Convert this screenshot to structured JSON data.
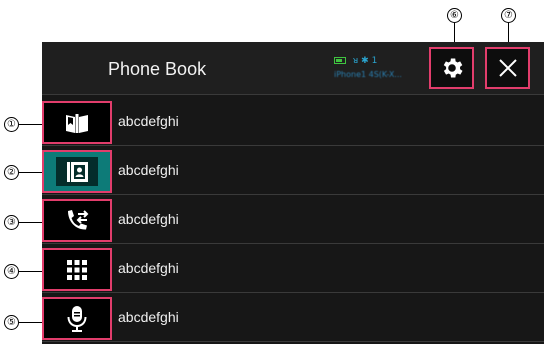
{
  "header": {
    "title": "Phone Book",
    "bt_indicator": "✱ 1",
    "device_name": "iPhone1 4S(K-X..."
  },
  "callouts": [
    "①",
    "②",
    "③",
    "④",
    "⑤",
    "⑥",
    "⑦"
  ],
  "list": {
    "items": [
      {
        "label": "abcdefghi",
        "icon": "phone-book-icon"
      },
      {
        "label": "abcdefghi",
        "icon": "contact-card-icon"
      },
      {
        "label": "abcdefghi",
        "icon": "call-history-icon"
      },
      {
        "label": "abcdefghi",
        "icon": "dial-pad-icon"
      },
      {
        "label": "abcdefghi",
        "icon": "voice-recognition-icon"
      }
    ],
    "selected_index": 1
  },
  "colors": {
    "highlight_border": "#e23d6c",
    "selected_tab": "#0d7b78",
    "status_green": "#3fc43f",
    "status_blue": "#2aa4cf"
  }
}
